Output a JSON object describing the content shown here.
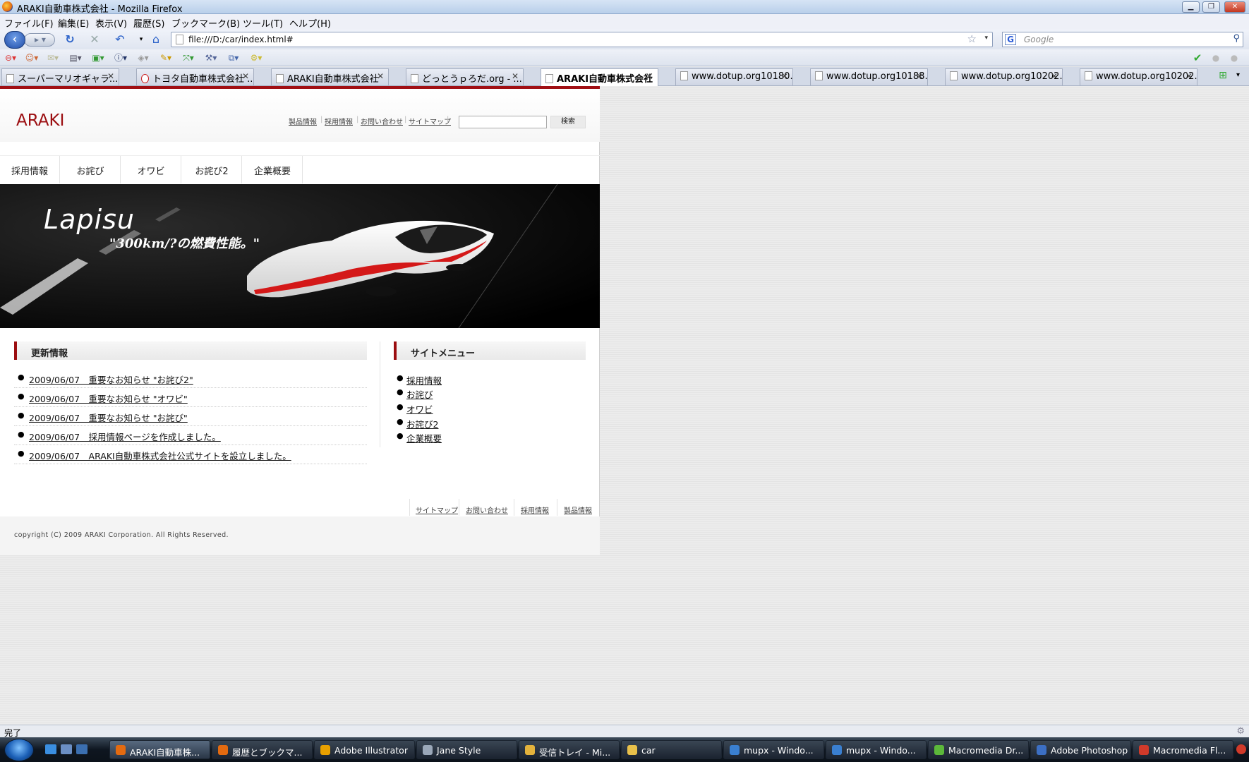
{
  "window": {
    "title": "ARAKI自動車株式会社 - Mozilla Firefox"
  },
  "menu": [
    "ファイル(F)",
    "編集(E)",
    "表示(V)",
    "履歴(S)",
    "ブックマーク(B)",
    "ツール(T)",
    "ヘルプ(H)"
  ],
  "nav": {
    "url": "file:///D:/car/index.html#",
    "search_placeholder": "Google"
  },
  "tabs": [
    {
      "label": "スーパーマリオギャラ..."
    },
    {
      "label": "トヨタ自動車株式会社 ..."
    },
    {
      "label": "ARAKI自動車株式会社"
    },
    {
      "label": "どっとうｐろだ.org - ..."
    },
    {
      "label": "ARAKI自動車株式会社",
      "active": true
    },
    {
      "label": "www.dotup.org10180..."
    },
    {
      "label": "www.dotup.org10188..."
    },
    {
      "label": "www.dotup.org10202..."
    },
    {
      "label": "www.dotup.org10202..."
    }
  ],
  "site": {
    "logo": "ARAKI",
    "header_links": [
      "製品情報",
      "採用情報",
      "お問い合わせ",
      "サイトマップ"
    ],
    "search_button": "検索",
    "gnav": [
      "採用情報",
      "お詫び",
      "オワビ",
      "お詫び2",
      "企業概要"
    ],
    "hero": {
      "brand": "Lapisu",
      "tagline": "\"300km/?の燃費性能。\""
    },
    "news": {
      "title": "更新情報",
      "items": [
        "2009/06/07　重要なお知らせ \"お詫び2\"",
        "2009/06/07　重要なお知らせ \"オワビ\"",
        "2009/06/07　重要なお知らせ \"お詫び\"",
        "2009/06/07　採用情報ページを作成しました。",
        "2009/06/07　ARAKI自動車株式会社公式サイトを設立しました。"
      ]
    },
    "sitemenu": {
      "title": "サイトメニュー",
      "items": [
        "採用情報",
        "お詫び",
        "オワビ",
        "お詫び2",
        "企業概要"
      ]
    },
    "footer_links": [
      "サイトマップ",
      "お問い合わせ",
      "採用情報",
      "製品情報"
    ],
    "copyright": "copyright (C) 2009 ARAKI Corporation. All Rights Reserved."
  },
  "status": "完了",
  "taskbar": [
    {
      "label": "ARAKI自動車株...",
      "color": "#e36a10",
      "active": true
    },
    {
      "label": "履歴とブックマ...",
      "color": "#e36a10"
    },
    {
      "label": "Adobe Illustrator",
      "color": "#e8a000"
    },
    {
      "label": "Jane Style",
      "color": "#9aa7b8"
    },
    {
      "label": "受信トレイ - Mi...",
      "color": "#e3b23c"
    },
    {
      "label": "car",
      "color": "#e8c04a"
    },
    {
      "label": "mupx - Windo...",
      "color": "#3a7fd0"
    },
    {
      "label": "mupx - Windo...",
      "color": "#3a7fd0"
    },
    {
      "label": "Macromedia Dr...",
      "color": "#5cb83a"
    },
    {
      "label": "Adobe Photoshop",
      "color": "#3c6fc4"
    },
    {
      "label": "Macromedia Fl...",
      "color": "#d03a2a"
    }
  ]
}
